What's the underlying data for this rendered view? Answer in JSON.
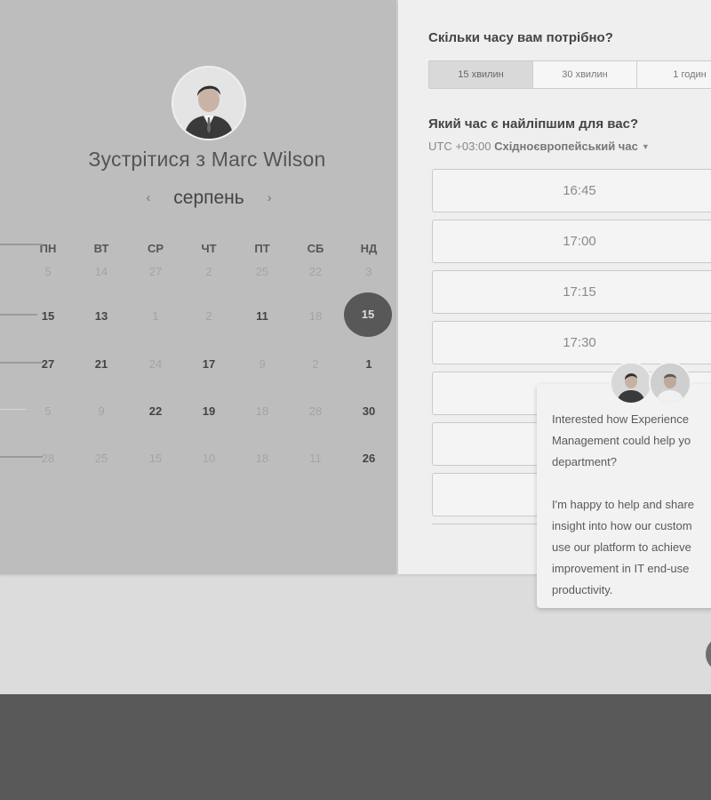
{
  "host": {
    "title": "Зустрітися з Marc Wilson",
    "avatar_icon": "person-avatar"
  },
  "calendar": {
    "month": "серпень",
    "prev_icon": "chevron-left-icon",
    "next_icon": "chevron-right-icon",
    "weekdays": [
      "ПН",
      "ВТ",
      "СР",
      "ЧТ",
      "ПТ",
      "СБ",
      "НД"
    ],
    "rows": [
      [
        "5",
        "14",
        "27",
        "2",
        "25",
        "22",
        "3"
      ],
      [
        "15",
        "13",
        "1",
        "2",
        "11",
        "18",
        "15"
      ],
      [
        "27",
        "21",
        "24",
        "17",
        "9",
        "2",
        "1"
      ],
      [
        "5",
        "9",
        "22",
        "19",
        "18",
        "28",
        "30"
      ],
      [
        "28",
        "25",
        "15",
        "10",
        "18",
        "11",
        "26"
      ]
    ],
    "selected_day": "15"
  },
  "duration": {
    "question": "Скільки часу вам потрібно?",
    "options": [
      "15 хвилин",
      "30 хвилин",
      "1 годин"
    ],
    "selected_index": 0
  },
  "time": {
    "question": "Який час є найліпшим для вас?",
    "timezone_offset": "UTC +03:00",
    "timezone_name": "Східноєвропейський час",
    "slots": [
      "16:45",
      "17:00",
      "17:15",
      "17:30",
      "",
      "",
      ""
    ]
  },
  "chat": {
    "message": "Interested how Experience\nManagement could help yo\ndepartment?\n\nI'm happy to help and share\ninsight into how our custom\nuse our platform to achieve\nimprovement in IT end-use\nproductivity.",
    "avatars": [
      "person-avatar-1",
      "person-avatar-2"
    ]
  },
  "colors": {
    "selected_day_bg": "#585858",
    "left_panel_bg": "#bdbdbd",
    "right_panel_bg": "#efefef",
    "footer_bg": "#595959"
  }
}
